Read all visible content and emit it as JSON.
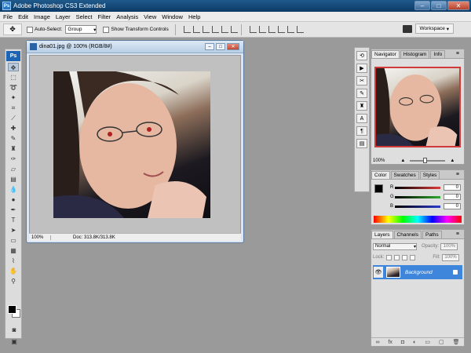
{
  "app": {
    "title": "Adobe Photoshop CS3 Extended",
    "logo": "Ps"
  },
  "menu": [
    "File",
    "Edit",
    "Image",
    "Layer",
    "Select",
    "Filter",
    "Analysis",
    "View",
    "Window",
    "Help"
  ],
  "options": {
    "auto_select_label": "Auto-Select:",
    "auto_select_value": "Group",
    "show_transform_label": "Show Transform Controls",
    "workspace_label": "Workspace"
  },
  "document": {
    "title": "dina01.jpg @ 100% (RGB/8#)",
    "zoom": "100%",
    "doc_info": "Doc: 313.8K/313.8K"
  },
  "navigator": {
    "tabs": [
      "Navigator",
      "Histogram",
      "Info"
    ],
    "zoom": "100%"
  },
  "color": {
    "tabs": [
      "Color",
      "Swatches",
      "Styles"
    ],
    "channels": [
      {
        "label": "R",
        "value": "0",
        "color": "#e03a3a"
      },
      {
        "label": "G",
        "value": "0",
        "color": "#2faa2f"
      },
      {
        "label": "B",
        "value": "0",
        "color": "#2a3ad0"
      }
    ]
  },
  "layers": {
    "tabs": [
      "Layers",
      "Channels",
      "Paths"
    ],
    "blend_mode": "Normal",
    "opacity_label": "Opacity:",
    "opacity_value": "100%",
    "lock_label": "Lock:",
    "fill_label": "Fill:",
    "fill_value": "100%",
    "items": [
      {
        "name": "Background",
        "selected": true
      }
    ]
  }
}
